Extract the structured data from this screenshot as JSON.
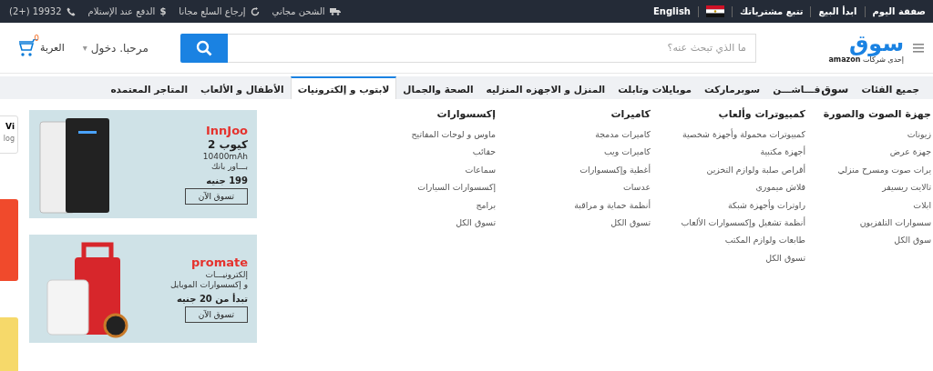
{
  "top_bar": {
    "right_items": [
      {
        "kind": "truck",
        "label": "الشحن مجاني"
      },
      {
        "kind": "return",
        "label": "إرجاع السلع مجانا"
      },
      {
        "kind": "dollar",
        "glyph": "$",
        "label": "الدفع عند الإستلام"
      },
      {
        "kind": "phone",
        "label": "19932 (+2)"
      }
    ],
    "left_links": [
      "صفقة اليوم",
      "ابدأ البيع",
      "تتبع مشترياتك"
    ],
    "language": "English"
  },
  "header": {
    "logo": "سوق",
    "tagline": "إحدى شركات",
    "tagline_brand": "amazon",
    "search": {
      "placeholder": "ما الذي تبحث عنه؟"
    },
    "account": "مرحبا. دخول",
    "account_caret": "▾",
    "cart": {
      "label": "العربة",
      "count": "0"
    }
  },
  "nav": [
    {
      "label": "جميع الفئات",
      "kind": "text",
      "selected": false
    },
    {
      "label": "سوق",
      "label_2": "فـــاشـــن",
      "kind": "brand",
      "selected": false
    },
    {
      "label": "سوبرماركت",
      "kind": "text",
      "selected": false
    },
    {
      "label": "موبايلات وتابلت",
      "kind": "text",
      "selected": false
    },
    {
      "label": "المنزل و الاجهزه المنزليه",
      "kind": "text",
      "selected": false
    },
    {
      "label": "الصحة والجمال",
      "kind": "text",
      "selected": false
    },
    {
      "label": "لابتوب و إلكترونيات",
      "kind": "text",
      "selected": true
    },
    {
      "label": "الأطفال و الألعاب",
      "kind": "text",
      "selected": false
    },
    {
      "label": "المتاجر المعتمده",
      "kind": "text",
      "selected": false
    }
  ],
  "menu_columns": [
    {
      "title": "جهزة الصوت والصورة",
      "items": [
        "زيونات",
        "جهزة عرض",
        "يرات صوت ومسرح منزلي",
        "تالايت ريسيفر",
        "ابلات",
        "سسوارات التلفزيون",
        "سوق الكل"
      ]
    },
    {
      "title": "كمبيوترات وألعاب",
      "items": [
        "كمبيوترات محمولة وأجهزة شخصية",
        "أجهزة مكتبية",
        "أقراص صلبة ولوازم التخزين",
        "فلاش ميموري",
        "راوترات وأجهزة شبكة",
        "أنظمة تشغيل وإكسسوارات الألعاب",
        "طابعات ولوازم المكتب",
        "تسوق الكل"
      ]
    },
    {
      "title": "كاميرات",
      "items": [
        "كاميرات مدمجة",
        "كاميرات ويب",
        "أغطية وإكسسوارات",
        "عدسات",
        "أنظمة حماية و مراقبة",
        "تسوق الكل"
      ]
    },
    {
      "title": "إكسسوارات",
      "items": [
        "ماوس و لوحات المفاتيح",
        "حقائب",
        "سماعات",
        "إكسسوارات السيارات",
        "برامج",
        "تسوق الكل"
      ]
    }
  ],
  "banners": [
    {
      "brand": "InnJoo",
      "kind": "innjoo",
      "lines": [
        "كيوب 2",
        "10400mAh",
        "بـــاور بانك"
      ],
      "price": "199 جنيه",
      "button": "تسوق الآن"
    },
    {
      "brand": "promate",
      "kind": "promate",
      "lines": [
        "إلكترونيـــات",
        "و إكسسوارات الموبايل"
      ],
      "price": "تبدأ من 20 جنيه",
      "button": "تسوق الآن"
    }
  ],
  "side_card": {
    "title": "Vi",
    "subtitle": "log"
  }
}
